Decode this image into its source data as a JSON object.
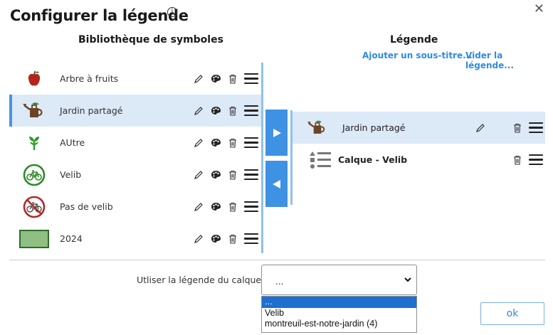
{
  "dialog": {
    "title": "Configurer la légende",
    "info_icon": "i",
    "close_icon": "✕"
  },
  "library": {
    "header": "Bibliothèque de symboles",
    "items": [
      {
        "label": "Arbre à fruits",
        "icon": "apple-icon"
      },
      {
        "label": "Jardin partagé",
        "icon": "watering-can-icon",
        "selected": true
      },
      {
        "label": "AUtre",
        "icon": "sprout-icon"
      },
      {
        "label": "Velib",
        "icon": "bicycle-icon"
      },
      {
        "label": "Pas de velib",
        "icon": "no-bicycle-icon"
      },
      {
        "label": "2024",
        "icon": "green-rectangle-swatch"
      }
    ]
  },
  "legend": {
    "header": "Légende",
    "add_subtitle_link": "Ajouter un sous-titre...",
    "clear_link": "Vider la légende...",
    "items": [
      {
        "label": "Jardin partagé",
        "icon": "watering-can-icon",
        "selected": true
      },
      {
        "label": "Calque - Velib",
        "icon": "layer-legend-icon",
        "bold": true
      }
    ]
  },
  "footer": {
    "select_label": "Utliser la légende du calque :",
    "selected_value": "...",
    "options": [
      "...",
      "Velib",
      "montreuil-est-notre-jardin (4)"
    ],
    "ok_label": "ok"
  },
  "colors": {
    "accent": "#3f91e3",
    "link": "#2f8ae5",
    "selected_bg": "#dce9f7",
    "swatch_fill": "#8fbf82",
    "swatch_border": "#2f6b2a"
  }
}
